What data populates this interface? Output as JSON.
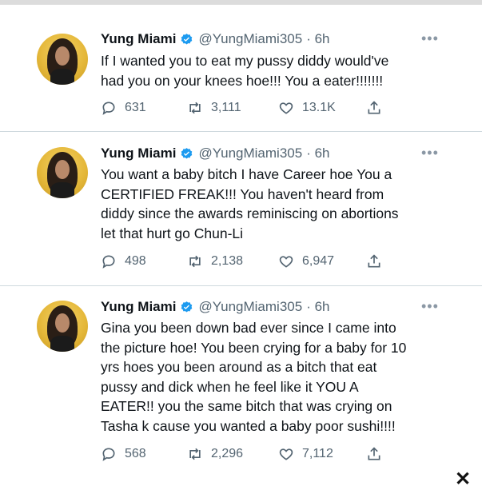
{
  "tweets": [
    {
      "name": "Yung Miami",
      "handle": "@YungMiami305",
      "time": "· 6h",
      "more": "•••",
      "lines": [
        "If I wanted you to eat my pussy diddy would've",
        "had you on your knees hoe!!! You a eater!!!!!!!"
      ],
      "replies": "631",
      "retweets": "3,111",
      "likes": "13.1K"
    },
    {
      "name": "Yung Miami",
      "handle": "@YungMiami305",
      "time": "· 6h",
      "more": "•••",
      "lines": [
        "You want a baby bitch I have Career hoe You a",
        "CERTIFIED FREAK!!! You haven't heard from",
        "diddy since the awards reminiscing on abortions",
        "let that hurt go Chun-Li"
      ],
      "replies": "498",
      "retweets": "2,138",
      "likes": "6,947"
    },
    {
      "name": "Yung Miami",
      "handle": "@YungMiami305",
      "time": "· 6h",
      "more": "•••",
      "lines": [
        "Gina you been down bad ever since I came into",
        "the picture hoe! You been crying for a baby for 10",
        "yrs hoes you been around as a bitch that eat",
        "pussy and dick when he feel like it YOU A",
        "EATER!! you the same bitch that was crying on",
        "Tasha k cause you wanted a baby poor sushi!!!!"
      ],
      "replies": "568",
      "retweets": "2,296",
      "likes": "7,112"
    }
  ],
  "close": "✕",
  "colors": {
    "verified": "#1d9bf0",
    "secondary": "#536471",
    "separator": "#cfd9de"
  }
}
